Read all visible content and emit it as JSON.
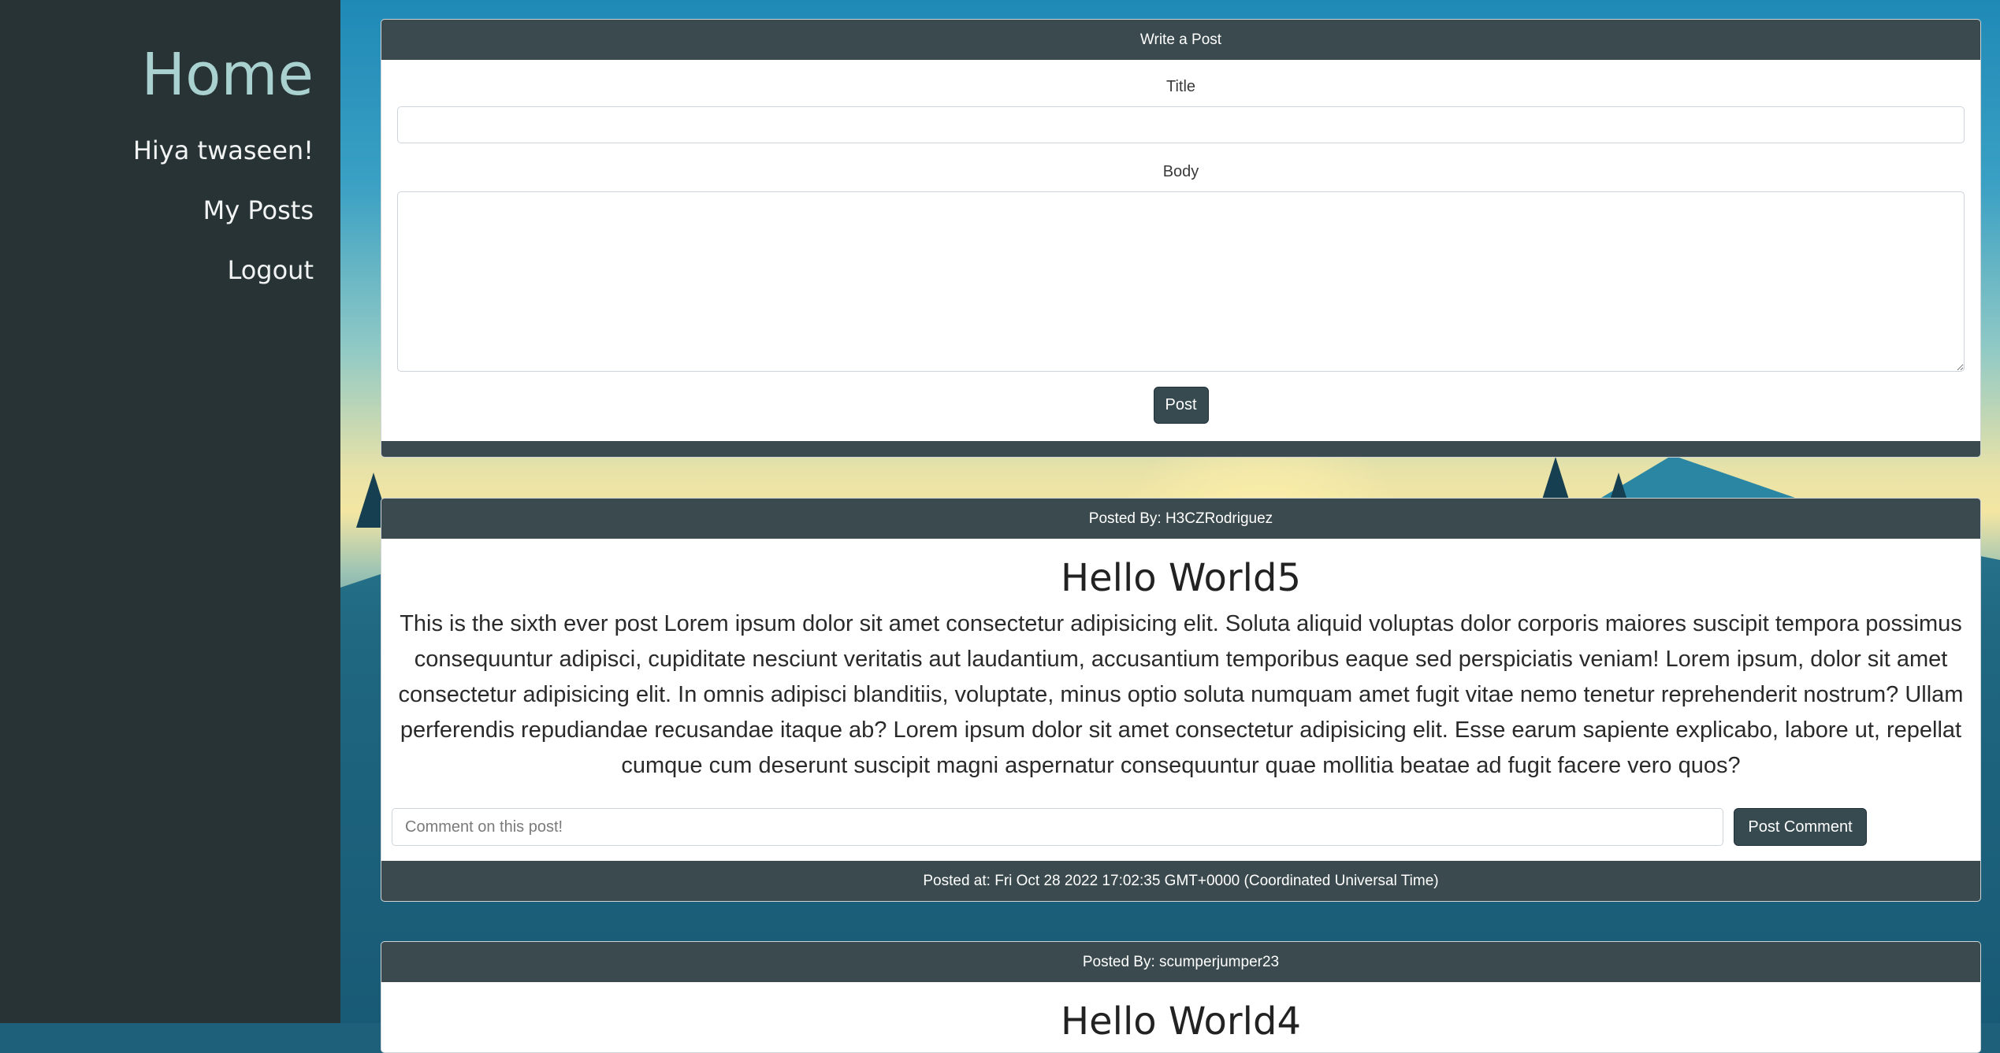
{
  "sidebar": {
    "title": "Home",
    "greeting": "Hiya twaseen!",
    "my_posts": "My Posts",
    "logout": "Logout"
  },
  "compose": {
    "header": "Write a Post",
    "title_label": "Title",
    "title_value": "",
    "body_label": "Body",
    "body_value": "",
    "post_button": "Post"
  },
  "posts": [
    {
      "author_line": "Posted By: H3CZRodriguez",
      "title": "Hello World5",
      "body": "This is the sixth ever post Lorem ipsum dolor sit amet consectetur adipisicing elit. Soluta aliquid voluptas dolor corporis maiores suscipit tempora possimus consequuntur adipisci, cupiditate nesciunt veritatis aut laudantium, accusantium temporibus eaque sed perspiciatis veniam! Lorem ipsum, dolor sit amet consectetur adipisicing elit. In omnis adipisci blanditiis, voluptate, minus optio soluta numquam amet fugit vitae nemo tenetur reprehenderit nostrum? Ullam perferendis repudiandae recusandae itaque ab? Lorem ipsum dolor sit amet consectetur adipisicing elit. Esse earum sapiente explicabo, labore ut, repellat cumque cum deserunt suscipit magni aspernatur consequuntur quae mollitia beatae ad fugit facere vero quos?",
      "comment_placeholder": "Comment on this post!",
      "comment_button": "Post Comment",
      "posted_at": "Posted at: Fri Oct 28 2022 17:02:35 GMT+0000 (Coordinated Universal Time)"
    },
    {
      "author_line": "Posted By: scumperjumper23",
      "title": "Hello World4"
    }
  ],
  "colors": {
    "sidebar_bg": "#283336",
    "home_title": "#a9d1cf",
    "card_header": "#3b4a4e",
    "button": "#364a50"
  }
}
